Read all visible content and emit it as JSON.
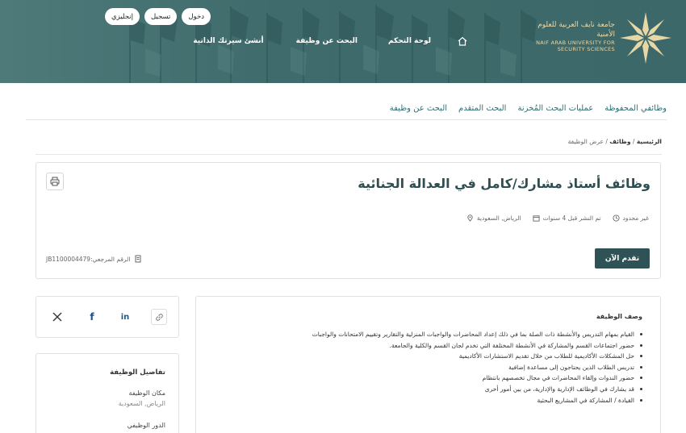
{
  "header": {
    "logo_ar": "جامعة نايف العربية للعلوم الأمنية",
    "logo_en": "NAIF ARAB UNIVERSITY FOR SECURITY SCIENCES",
    "nav": [
      "لوحة التحكم",
      "البحث عن وظيفة",
      "أنشئ سيرتك الذاتية"
    ],
    "buttons": {
      "login": "دخول",
      "register": "تسجيل",
      "language": "إنجليزي"
    },
    "colors": {
      "banner": "#3e6a6b",
      "logo_gold": "#e8d7a6"
    }
  },
  "tabs": [
    "البحث عن وظيفة",
    "البحث المتقدم",
    "عمليات البحث المُخزنة",
    "وظائفي المحفوظة"
  ],
  "breadcrumb": {
    "home": "الرئيسية",
    "sep1": " / ",
    "jobs": "وظائف",
    "sep2": " / ",
    "current": "عرض الوظيفة"
  },
  "job": {
    "title": "وظائف أستاذ مشارك/كامل في العدالة الجنائية",
    "location": "الرياض, السعودية",
    "posted": "تم النشر قبل 4 سنوات",
    "duration": "غير محدود",
    "apply_label": "تقدم الآن",
    "reference": "الرقم المرجعي:JB1100004479"
  },
  "details": {
    "title": "تفاصيل الوظيفة",
    "location_label": "مكان الوظيفة",
    "location_value": "الرياض, السعودية",
    "role_label": "الدور الوظيفي"
  },
  "description": {
    "title": "وصف الوظيفة",
    "items": [
      "القيام بمهام التدريس والأنشطة ذات الصلة بما في ذلك إعداد المحاضرات والواجبات المنزلية والتقارير وتقييم الامتحانات والواجبات",
      "حضور اجتماعات القسم والمشاركة في الأنشطة المختلفة التي تخدم لجان القسم والكلية والجامعة.",
      "حل المشكلات الأكاديمية للطلاب من خلال تقديم الاستشارات الأكاديمية",
      "تدريس الطلاب الذين يحتاجون إلى مساعدة إضافية",
      "حضور الندوات وإلقاء المحاضرات في مجال تخصصهم بانتظام",
      "قد يشارك في الوظائف الإدارية والإدارية، من بين أمور أخرى",
      "القيادة / المشاركة في المشاريع البحثية"
    ]
  },
  "accent_color": "#2f6f73"
}
